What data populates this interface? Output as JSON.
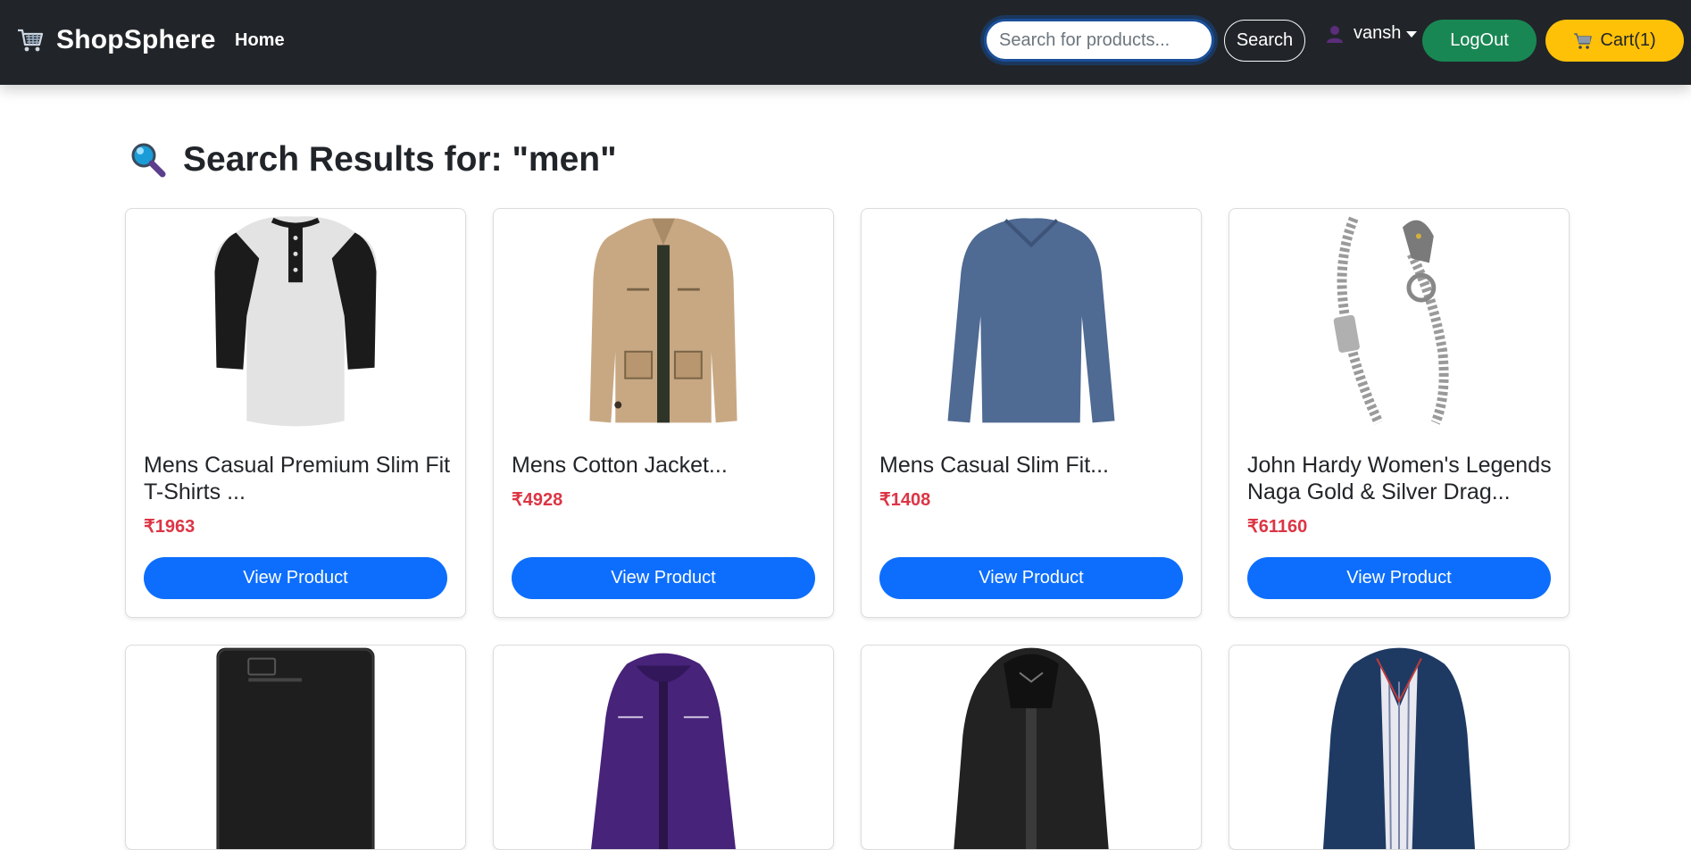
{
  "navbar": {
    "brand": "ShopSphere",
    "home_label": "Home",
    "search_placeholder": "Search for products...",
    "search_label": "Search",
    "username": "vansh",
    "logout_label": "LogOut",
    "cart_label": "Cart(1)"
  },
  "page": {
    "heading": "Search Results for: \"men\""
  },
  "products": [
    {
      "title": "Mens Casual Premium Slim Fit T-Shirts ...",
      "price": "₹1963",
      "button": "View Product",
      "image": "raglan-henley-tshirt"
    },
    {
      "title": "Mens Cotton Jacket...",
      "price": "₹4928",
      "button": "View Product",
      "image": "khaki-cotton-jacket"
    },
    {
      "title": "Mens Casual Slim Fit...",
      "price": "₹1408",
      "button": "View Product",
      "image": "blue-longsleeve-tee"
    },
    {
      "title": "John Hardy Women's Legends Naga Gold & Silver Drag...",
      "price": "₹61160",
      "button": "View Product",
      "image": "dragon-chain-bracelet"
    },
    {
      "image": "black-portable-hard-drive"
    },
    {
      "image": "purple-hooded-jacket"
    },
    {
      "image": "black-leather-hooded-jacket"
    },
    {
      "image": "navy-trench-jacket"
    }
  ],
  "colors": {
    "navbar_bg": "#212529",
    "primary": "#0d6efd",
    "success": "#198754",
    "warning": "#ffc107",
    "price": "#dc3545"
  }
}
